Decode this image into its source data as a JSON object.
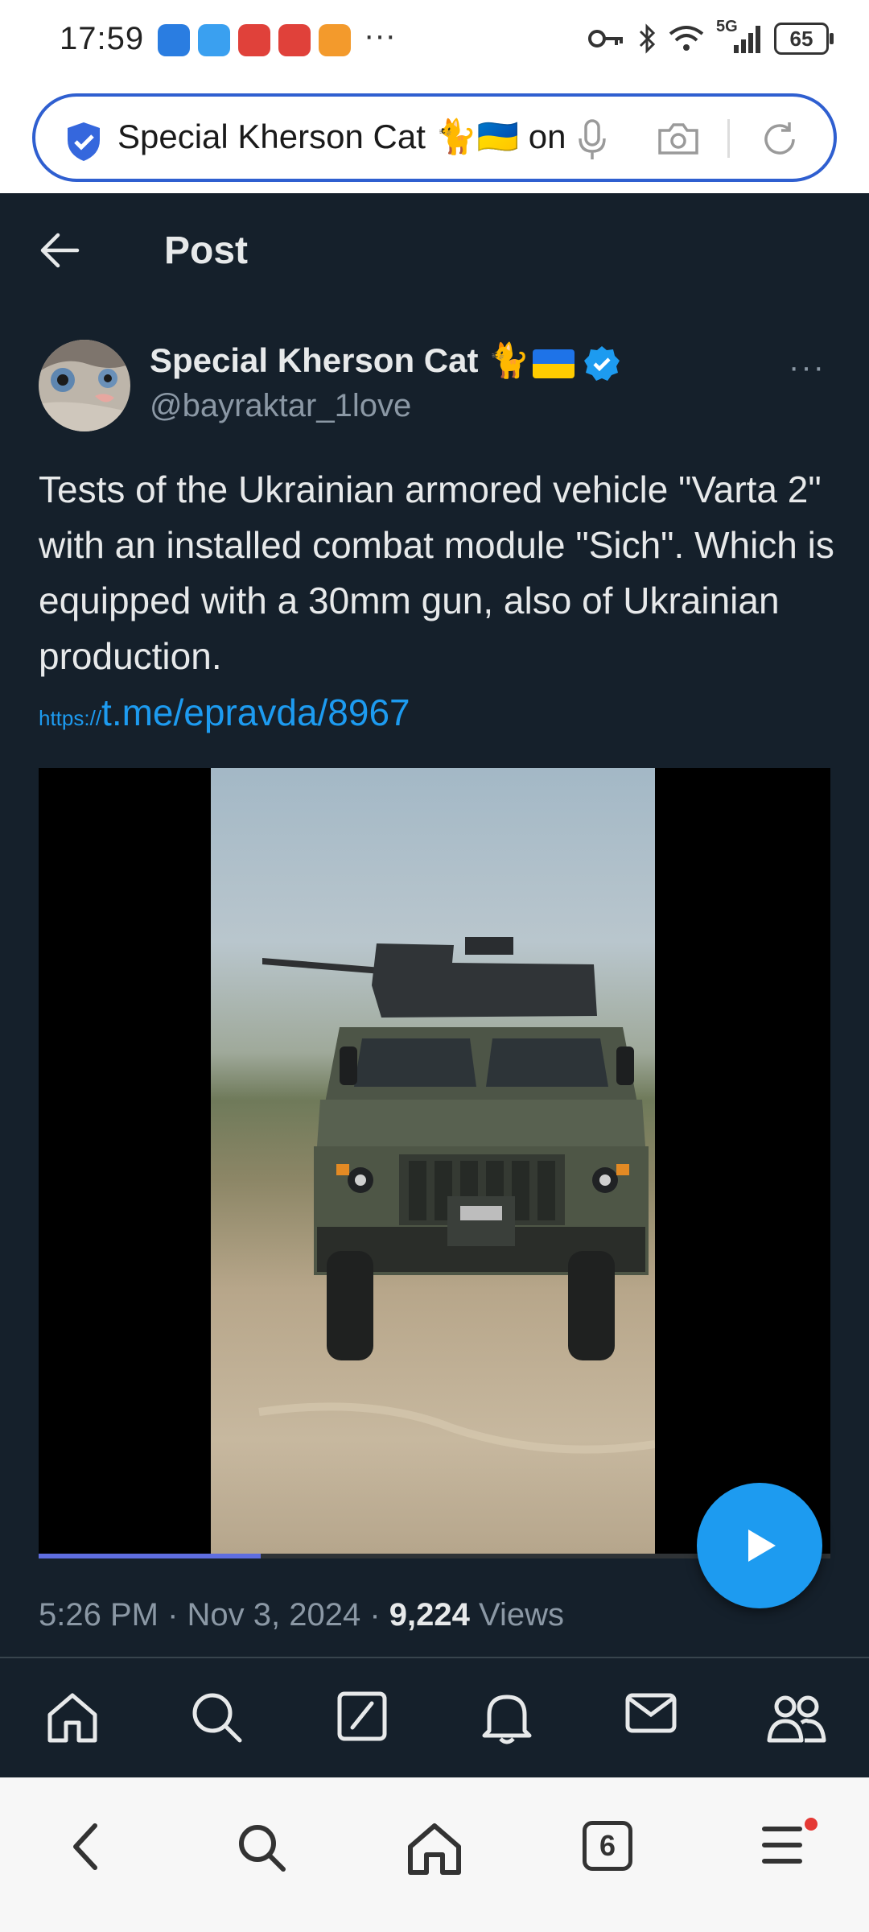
{
  "status_bar": {
    "time": "17:59",
    "network": "5G",
    "battery": "65",
    "app_icons": [
      "mail-app-icon",
      "weather-app-icon",
      "news-app-icon",
      "news-app-icon-2",
      "video-app-icon"
    ],
    "overflow": "···"
  },
  "browser": {
    "url_text": "Special Kherson Cat 🐈🇺🇦 on X",
    "icons": [
      "shield-check-icon",
      "microphone-icon",
      "camera-icon",
      "reload-icon"
    ]
  },
  "header": {
    "title": "Post"
  },
  "post": {
    "author_name": "Special Kherson Cat",
    "author_emoji": "🐈",
    "handle": "@bayraktar_1love",
    "more": "···",
    "text": "Tests of the Ukrainian armored vehicle \"Varta 2\" with an installed combat module \"Sich\". Which is equipped with a 30mm gun, also of Ukrainian production.",
    "link_protocol": "https://",
    "link_path": "t.me/epravda/8967",
    "video_progress_fraction": 0.28,
    "time": "5:26 PM",
    "date": "Nov 3, 2024",
    "separator": " · ",
    "views_count": "9,224",
    "views_label": " Views"
  },
  "colors": {
    "background": "#15202b",
    "accent": "#1d9bf0",
    "text_primary": "#e7e9ea",
    "text_secondary": "#8b98a5",
    "url_border": "#2f5fd0"
  },
  "tab_bar": {
    "items": [
      "home-icon",
      "search-icon",
      "compose-icon",
      "notifications-icon",
      "messages-icon",
      "communities-icon"
    ]
  },
  "nav_bar": {
    "tabs_count": "6",
    "items": [
      "back-icon",
      "search-icon",
      "home-icon",
      "tabs-icon",
      "menu-icon"
    ]
  }
}
